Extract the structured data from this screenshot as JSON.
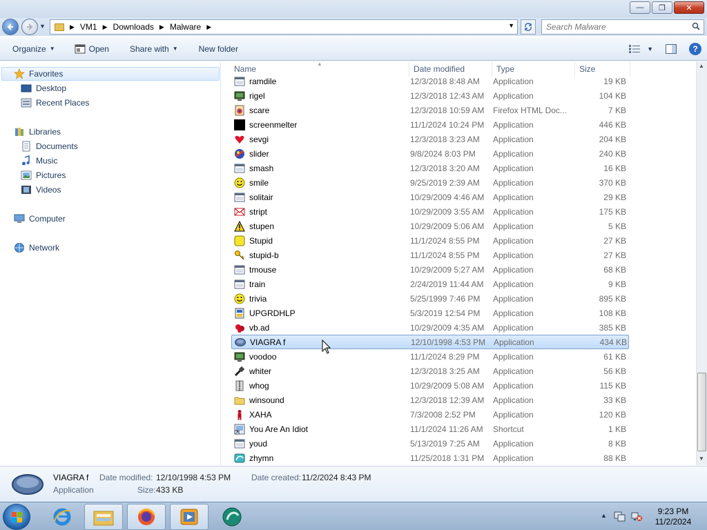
{
  "window": {
    "minimize_glyph": "—",
    "maximize_glyph": "❐",
    "close_glyph": "✕"
  },
  "address": {
    "crumbs": [
      "VM1",
      "Downloads",
      "Malware"
    ],
    "search_placeholder": "Search Malware"
  },
  "toolbar": {
    "organize": "Organize",
    "open": "Open",
    "share_with": "Share with",
    "new_folder": "New folder"
  },
  "nav": {
    "favorites": "Favorites",
    "desktop": "Desktop",
    "recent_places": "Recent Places",
    "libraries": "Libraries",
    "documents": "Documents",
    "music": "Music",
    "pictures": "Pictures",
    "videos": "Videos",
    "computer": "Computer",
    "network": "Network"
  },
  "columns": {
    "name": "Name",
    "date": "Date modified",
    "type": "Type",
    "size": "Size"
  },
  "files": [
    {
      "name": "ramdile",
      "date": "12/3/2018 8:48 AM",
      "type": "Application",
      "size": "19 KB",
      "icon": "app-window-icon"
    },
    {
      "name": "rigel",
      "date": "12/3/2018 12:43 AM",
      "type": "Application",
      "size": "104 KB",
      "icon": "monitor-icon"
    },
    {
      "name": "scare",
      "date": "12/3/2018 10:59 AM",
      "type": "Firefox HTML Doc...",
      "size": "7 KB",
      "icon": "html-doc-icon"
    },
    {
      "name": "screenmelter",
      "date": "11/1/2024 10:24 PM",
      "type": "Application",
      "size": "446 KB",
      "icon": "black-square-icon"
    },
    {
      "name": "sevgi",
      "date": "12/3/2018 3:23 AM",
      "type": "Application",
      "size": "204 KB",
      "icon": "heart-icon"
    },
    {
      "name": "slider",
      "date": "9/8/2024 8:03 PM",
      "type": "Application",
      "size": "240 KB",
      "icon": "slider-app-icon"
    },
    {
      "name": "smash",
      "date": "12/3/2018 3:20 AM",
      "type": "Application",
      "size": "16 KB",
      "icon": "app-window-icon"
    },
    {
      "name": "smile",
      "date": "9/25/2019 2:39 AM",
      "type": "Application",
      "size": "370 KB",
      "icon": "smiley-icon"
    },
    {
      "name": "solitair",
      "date": "10/29/2009 4:46 AM",
      "type": "Application",
      "size": "29 KB",
      "icon": "app-window-icon"
    },
    {
      "name": "stript",
      "date": "10/29/2009 3:55 AM",
      "type": "Application",
      "size": "175 KB",
      "icon": "envelope-icon"
    },
    {
      "name": "stupen",
      "date": "10/29/2009 5:06 AM",
      "type": "Application",
      "size": "5 KB",
      "icon": "warning-icon"
    },
    {
      "name": "Stupid",
      "date": "11/1/2024 8:55 PM",
      "type": "Application",
      "size": "27 KB",
      "icon": "yellow-square-icon"
    },
    {
      "name": "stupid-b",
      "date": "11/1/2024 8:55 PM",
      "type": "Application",
      "size": "27 KB",
      "icon": "key-icon"
    },
    {
      "name": "tmouse",
      "date": "10/29/2009 5:27 AM",
      "type": "Application",
      "size": "68 KB",
      "icon": "app-window-icon"
    },
    {
      "name": "train",
      "date": "2/24/2019 11:44 AM",
      "type": "Application",
      "size": "9 KB",
      "icon": "app-window-icon"
    },
    {
      "name": "trivia",
      "date": "5/25/1999 7:46 PM",
      "type": "Application",
      "size": "895 KB",
      "icon": "smiley-icon"
    },
    {
      "name": "UPGRDHLP",
      "date": "5/3/2019 12:54 PM",
      "type": "Application",
      "size": "108 KB",
      "icon": "installer-icon"
    },
    {
      "name": "vb.ad",
      "date": "10/29/2009 4:35 AM",
      "type": "Application",
      "size": "385 KB",
      "icon": "red-blob-icon"
    },
    {
      "name": "VIAGRA f",
      "date": "12/10/1998 4:53 PM",
      "type": "Application",
      "size": "434 KB",
      "icon": "viagra-pill-icon"
    },
    {
      "name": "voodoo",
      "date": "11/1/2024 8:29 PM",
      "type": "Application",
      "size": "61 KB",
      "icon": "monitor-icon"
    },
    {
      "name": "whiter",
      "date": "12/3/2018 3:25 AM",
      "type": "Application",
      "size": "56 KB",
      "icon": "brush-icon"
    },
    {
      "name": "whog",
      "date": "10/29/2009 5:08 AM",
      "type": "Application",
      "size": "115 KB",
      "icon": "zipper-icon"
    },
    {
      "name": "winsound",
      "date": "12/3/2018 12:39 AM",
      "type": "Application",
      "size": "33 KB",
      "icon": "folder-icon"
    },
    {
      "name": "XAHA",
      "date": "7/3/2008 2:52 PM",
      "type": "Application",
      "size": "120 KB",
      "icon": "red-figure-icon"
    },
    {
      "name": "You Are An Idiot",
      "date": "11/1/2024 11:26 AM",
      "type": "Shortcut",
      "size": "1 KB",
      "icon": "shortcut-icon"
    },
    {
      "name": "youd",
      "date": "5/13/2019 7:25 AM",
      "type": "Application",
      "size": "8 KB",
      "icon": "app-window-icon"
    },
    {
      "name": "zhymn",
      "date": "11/25/2018 1:31 PM",
      "type": "Application",
      "size": "88 KB",
      "icon": "teal-app-icon"
    }
  ],
  "selected_index": 18,
  "details": {
    "name": "VIAGRA f",
    "kind": "Application",
    "date_modified_label": "Date modified:",
    "date_modified": "12/10/1998 4:53 PM",
    "size_label": "Size:",
    "size": "433 KB",
    "date_created_label": "Date created:",
    "date_created": "11/2/2024 8:43 PM"
  },
  "taskbar": {
    "time": "9:23 PM",
    "date": "11/2/2024"
  },
  "colors": {
    "selection_bg": "#cce4fc",
    "selection_border": "#7da2ce",
    "link_text": "#1e395b"
  }
}
